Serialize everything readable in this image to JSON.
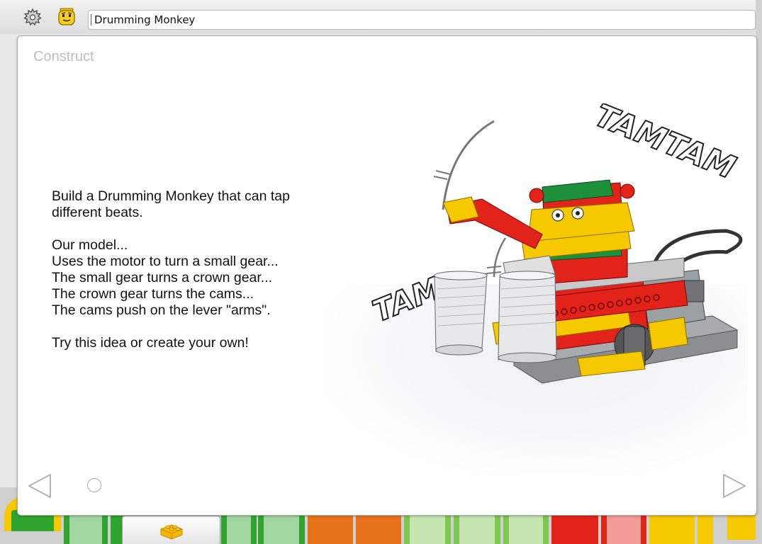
{
  "window": {
    "title": "Drumming Monkey"
  },
  "toolbar": {
    "icons": [
      "gear-icon",
      "minifig-face-icon"
    ]
  },
  "content": {
    "heading": "Construct",
    "lines": [
      "Build a Drumming Monkey that can tap",
      "different beats.",
      "",
      "Our model...",
      "Uses the motor to turn a small gear...",
      "The small gear turns a crown gear...",
      "The crown gear turns the cams...",
      "The cams push on the lever \"arms\".",
      "",
      "Try this idea or create your own!"
    ],
    "illustration": {
      "sound_words": [
        "TAMTAM",
        "TAM"
      ]
    }
  },
  "navigation": {
    "page_count": 1,
    "current_page": 1
  },
  "palette": {
    "active_tab_icon": "lego-brick-icon"
  },
  "colors": {
    "green": "#2fa52f",
    "orange": "#e8711c",
    "light_green": "#7ec850",
    "red": "#e2231a",
    "yellow": "#f5c800"
  }
}
